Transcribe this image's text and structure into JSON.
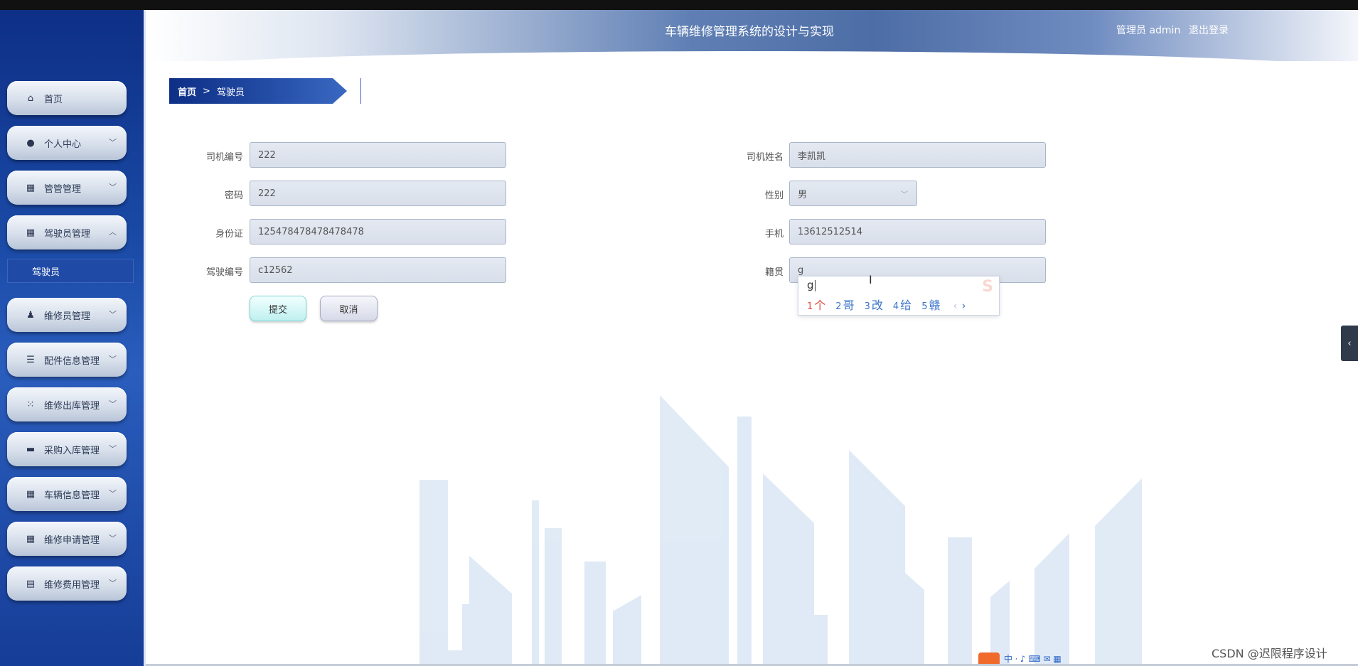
{
  "app": {
    "title": "车辆维修管理系统的设计与实现",
    "user_label": "管理员 admin",
    "logout_label": "退出登录"
  },
  "sidebar": {
    "items": [
      {
        "label": "首页",
        "icon": "home-icon"
      },
      {
        "label": "个人中心",
        "icon": "user-icon"
      },
      {
        "label": "管管管理",
        "icon": "grid-icon"
      },
      {
        "label": "驾驶员管理",
        "icon": "grid-icon"
      },
      {
        "label": "维修员管理",
        "icon": "person-icon"
      },
      {
        "label": "配件信息管理",
        "icon": "list-icon"
      },
      {
        "label": "维修出库管理",
        "icon": "apps-icon"
      },
      {
        "label": "采购入库管理",
        "icon": "briefcase-icon"
      },
      {
        "label": "车辆信息管理",
        "icon": "grid-icon"
      },
      {
        "label": "维修申请管理",
        "icon": "grid-icon"
      },
      {
        "label": "维修费用管理",
        "icon": "clipboard-icon"
      }
    ],
    "active_sub_item": "驾驶员"
  },
  "breadcrumb": {
    "home": "首页",
    "separator": ">",
    "current": "驾驶员"
  },
  "form": {
    "driver_id_label": "司机编号",
    "driver_id_value": "222",
    "driver_name_label": "司机姓名",
    "driver_name_value": "李凯凯",
    "password_label": "密码",
    "password_value": "222",
    "gender_label": "性别",
    "gender_value": "男",
    "id_card_label": "身份证",
    "id_card_value": "125478478478478478",
    "phone_label": "手机",
    "phone_value": "13612512514",
    "license_label": "驾驶编号",
    "license_value": "c12562",
    "hometown_label": "籍贯",
    "hometown_value": "g",
    "submit_label": "提交",
    "cancel_label": "取消"
  },
  "ime": {
    "input": "g",
    "candidates": [
      {
        "num": "1",
        "text": "个"
      },
      {
        "num": "2",
        "text": "哥"
      },
      {
        "num": "3",
        "text": "改"
      },
      {
        "num": "4",
        "text": "给"
      },
      {
        "num": "5",
        "text": "赣"
      }
    ],
    "prev": "‹",
    "next": "›"
  },
  "watermark": "CSDN @迟限程序设计",
  "tray_text": "中 ⸱ ♪ ⌨ ✉ ▦",
  "colors": {
    "sidebar": "#1a4aa6",
    "accent_candidate": "#e0453c",
    "candidate": "#3a74c9"
  }
}
